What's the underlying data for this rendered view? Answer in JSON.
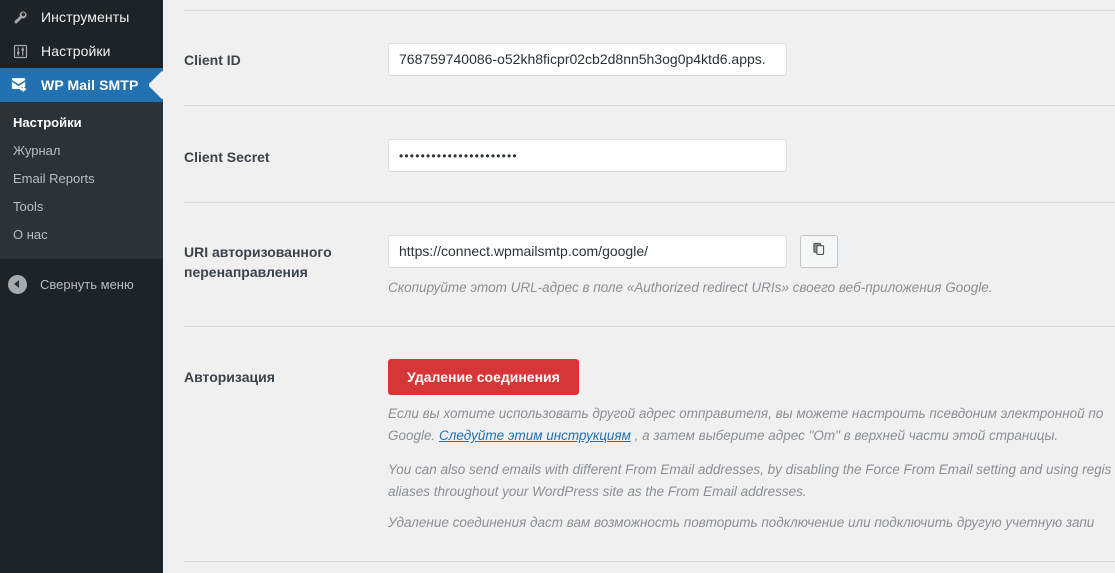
{
  "sidebar": {
    "menu": [
      {
        "label": "Инструменты",
        "icon": "wrench-icon",
        "current": false
      },
      {
        "label": "Настройки",
        "icon": "settings-sliders-icon",
        "current": false
      },
      {
        "label": "WP Mail SMTP",
        "icon": "mail-forward-icon",
        "current": true
      }
    ],
    "submenu": [
      {
        "label": "Настройки",
        "active": true
      },
      {
        "label": "Журнал",
        "active": false
      },
      {
        "label": "Email Reports",
        "active": false
      },
      {
        "label": "Tools",
        "active": false
      },
      {
        "label": "О нас",
        "active": false
      }
    ],
    "collapse_label": "Свернуть меню",
    "bg_color": "#1d2327",
    "submenu_bg_color": "#2c3338",
    "active_color": "#2271b1"
  },
  "form": {
    "client_id": {
      "label": "Client ID",
      "value": "768759740086-o52kh8ficpr02cb2d8nn5h3og0p4ktd6.apps."
    },
    "client_secret": {
      "label": "Client Secret",
      "value": "••••••••••••••••••••••"
    },
    "redirect_uri": {
      "label_line1": "URI авторизованного",
      "label_line2": "перенаправления",
      "value": "https://connect.wpmailsmtp.com/google/",
      "copy_icon": "copy-icon",
      "description": "Скопируйте этот URL-адрес в поле «Authorized redirect URIs» своего веб-приложения Google."
    },
    "authorization": {
      "label": "Авторизация",
      "remove_button_label": "Удаление соединения",
      "remove_button_color": "#d63638",
      "paragraph1_line1": "Если вы хотите использовать другой адрес отправителя, вы можете настроить псевдоним электронной по",
      "paragraph1_line2_pre": "Google. ",
      "paragraph1_link": "Следуйте этим инструкциям",
      "paragraph1_line2_post": " , а затем выберите адрес \"От\" в верхней части этой страницы.",
      "paragraph2_line1": "You can also send emails with different From Email addresses, by disabling the Force From Email setting and using regis",
      "paragraph2_line2": "aliases throughout your WordPress site as the From Email addresses.",
      "paragraph3": "Удаление соединения даст вам возможность повторить подключение или подключить другую учетную запи"
    }
  }
}
